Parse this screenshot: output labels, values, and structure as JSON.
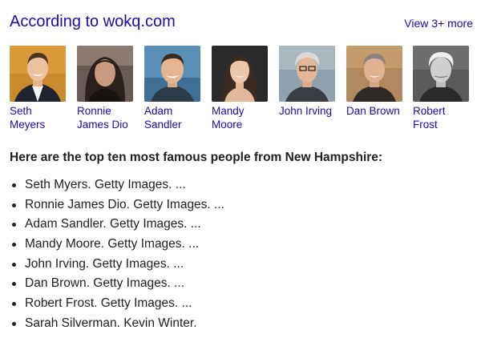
{
  "header": {
    "source_title": "According to wokq.com",
    "view_more": "View 3+ more"
  },
  "people": [
    {
      "name": "Seth Meyers",
      "portrait_icon": "seth-meyers-portrait"
    },
    {
      "name": "Ronnie James Dio",
      "portrait_icon": "ronnie-james-dio-portrait"
    },
    {
      "name": "Adam Sandler",
      "portrait_icon": "adam-sandler-portrait"
    },
    {
      "name": "Mandy Moore",
      "portrait_icon": "mandy-moore-portrait"
    },
    {
      "name": "John Irving",
      "portrait_icon": "john-irving-portrait"
    },
    {
      "name": "Dan Brown",
      "portrait_icon": "dan-brown-portrait"
    },
    {
      "name": "Robert Frost",
      "portrait_icon": "robert-frost-portrait"
    }
  ],
  "answer": {
    "heading": "Here are the top ten most famous people from New Hampshire:",
    "items": [
      "Seth Myers. Getty Images. ...",
      "Ronnie James Dio. Getty Images. ...",
      "Adam Sandler. Getty Images. ...",
      "Mandy Moore. Getty Images. ...",
      "John Irving. Getty Images. ...",
      "Dan Brown. Getty Images. ...",
      "Robert Frost. Getty Images. ...",
      "Sarah Silverman. Kevin Winter."
    ]
  },
  "colors": {
    "link": "#1a0dab",
    "text": "#202124",
    "background": "#ffffff"
  }
}
